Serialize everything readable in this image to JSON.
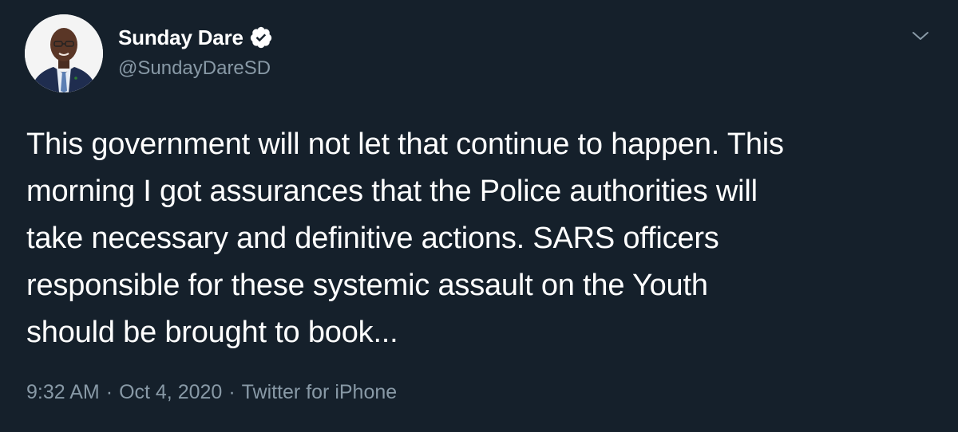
{
  "author": {
    "display_name": "Sunday Dare",
    "handle": "@SundayDareSD",
    "verified": true,
    "avatar_icon": "profile-photo"
  },
  "tweet": {
    "text": "This government will not let that continue to happen. This\nmorning I got assurances that the Police authorities will\ntake necessary and definitive actions. SARS officers\nresponsible for these systemic assault on the Youth\nshould be brought to book...",
    "time": "9:32 AM",
    "date": "Oct 4, 2020",
    "separator": "·",
    "source": "Twitter for iPhone"
  },
  "colors": {
    "background": "#15202b",
    "text": "#ffffff",
    "secondary_text": "#8899a6",
    "verified_badge": "#ffffff"
  },
  "icons": {
    "verified": "verified-badge-icon",
    "menu": "chevron-down-icon"
  }
}
